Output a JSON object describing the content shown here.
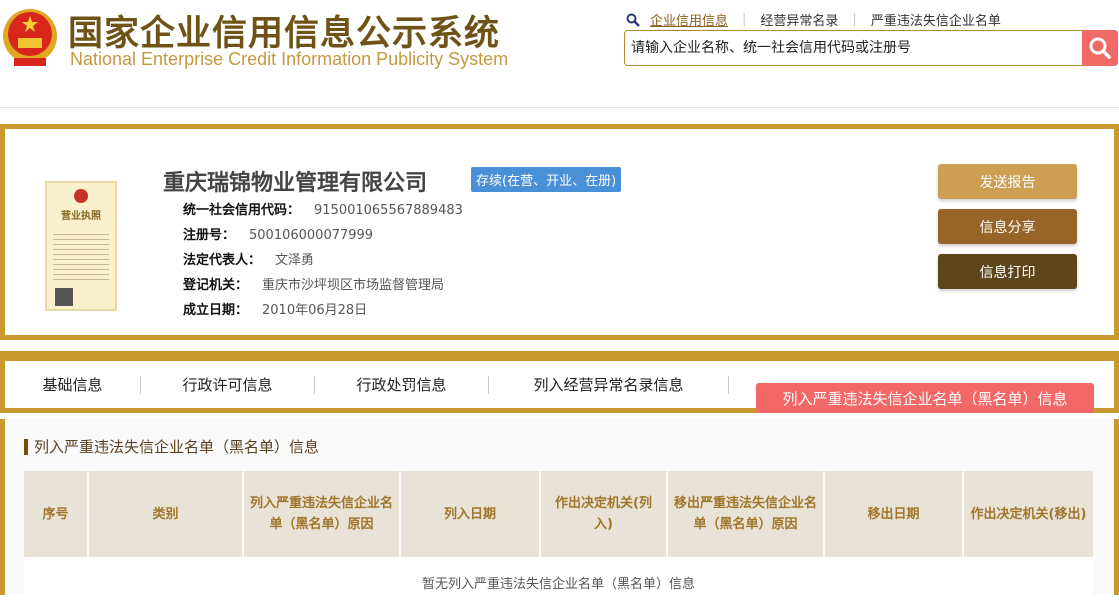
{
  "header": {
    "title_cn": "国家企业信用信息公示系统",
    "title_en": "National Enterprise Credit Information Publicity System",
    "nav": [
      "企业信用信息",
      "经营异常名录",
      "严重违法失信企业名单"
    ],
    "search_placeholder": "请输入企业名称、统一社会信用代码或注册号"
  },
  "company": {
    "name": "重庆瑞锦物业管理有限公司",
    "status": "存续(在营、开业、在册)",
    "fields": [
      {
        "label": "统一社会信用代码：",
        "value": "915001065567889483"
      },
      {
        "label": "注册号：",
        "value": "500106000077999"
      },
      {
        "label": "法定代表人：",
        "value": "文泽勇"
      },
      {
        "label": "登记机关：",
        "value": "重庆市沙坪坝区市场监督管理局"
      },
      {
        "label": "成立日期：",
        "value": "2010年06月28日"
      }
    ],
    "license_title": "营业执照"
  },
  "actions": {
    "send": "发送报告",
    "share": "信息分享",
    "print": "信息打印"
  },
  "tabs": [
    "基础信息",
    "行政许可信息",
    "行政处罚信息",
    "列入经营异常名录信息",
    "列入严重违法失信企业名单（黑名单）信息"
  ],
  "section": {
    "title": "列入严重违法失信企业名单（黑名单）信息",
    "columns": [
      "序号",
      "类别",
      "列入严重违法失信企业名单（黑名单）原因",
      "列入日期",
      "作出决定机关(列入)",
      "移出严重违法失信企业名单（黑名单）原因",
      "移出日期",
      "作出决定机关(移出)"
    ],
    "empty": "暂无列入严重违法失信企业名单（黑名单）信息"
  },
  "colors": {
    "gold": "#c9992f",
    "brown": "#6e5216",
    "red": "#f26866",
    "blue": "#4a90d9"
  }
}
